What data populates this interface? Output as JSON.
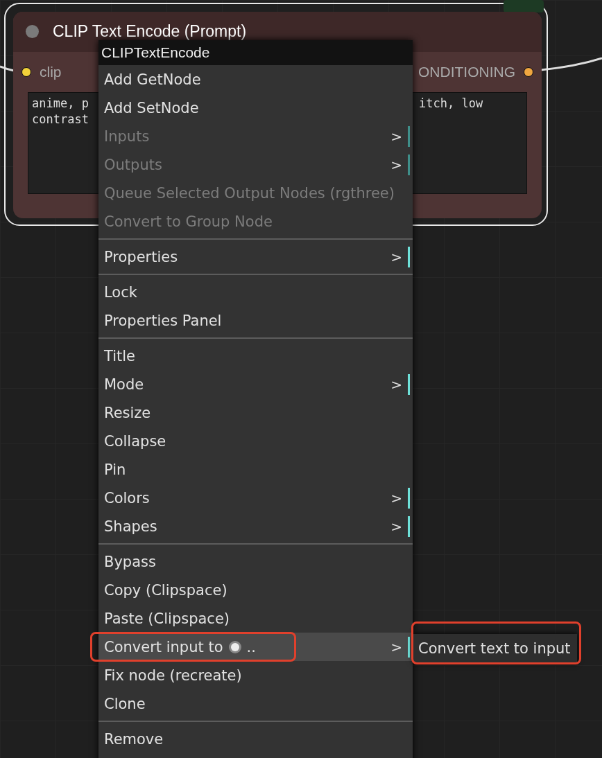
{
  "node": {
    "title": "CLIP Text Encode (Prompt)",
    "selected": true,
    "input": {
      "label": "clip",
      "color": "#f2d13a"
    },
    "output": {
      "label": "ONDITIONING",
      "color": "#f0a640"
    },
    "text_lines": [
      {
        "left": "anime, p",
        "right": "itch, low"
      },
      {
        "left": "contrast"
      }
    ]
  },
  "context_menu": {
    "title": "CLIPTextEncode",
    "items": [
      {
        "kind": "item",
        "label": "Add GetNode",
        "disabled": false,
        "submenu": false,
        "selected": false
      },
      {
        "kind": "item",
        "label": "Add SetNode",
        "disabled": false,
        "submenu": false,
        "selected": false
      },
      {
        "kind": "item",
        "label": "Inputs",
        "disabled": true,
        "submenu": true,
        "selected": false
      },
      {
        "kind": "item",
        "label": "Outputs",
        "disabled": true,
        "submenu": true,
        "selected": false
      },
      {
        "kind": "item",
        "label": "Queue Selected Output Nodes (rgthree)",
        "disabled": true,
        "submenu": false,
        "selected": false
      },
      {
        "kind": "item",
        "label": "Convert to Group Node",
        "disabled": true,
        "submenu": false,
        "selected": false
      },
      {
        "kind": "separator"
      },
      {
        "kind": "item",
        "label": "Properties",
        "disabled": false,
        "submenu": true,
        "selected": false
      },
      {
        "kind": "separator"
      },
      {
        "kind": "item",
        "label": "Lock",
        "disabled": false,
        "submenu": false,
        "selected": false
      },
      {
        "kind": "item",
        "label": "Properties Panel",
        "disabled": false,
        "submenu": false,
        "selected": false
      },
      {
        "kind": "separator"
      },
      {
        "kind": "item",
        "label": "Title",
        "disabled": false,
        "submenu": false,
        "selected": false
      },
      {
        "kind": "item",
        "label": "Mode",
        "disabled": false,
        "submenu": true,
        "selected": false
      },
      {
        "kind": "item",
        "label": "Resize",
        "disabled": false,
        "submenu": false,
        "selected": false
      },
      {
        "kind": "item",
        "label": "Collapse",
        "disabled": false,
        "submenu": false,
        "selected": false
      },
      {
        "kind": "item",
        "label": "Pin",
        "disabled": false,
        "submenu": false,
        "selected": false
      },
      {
        "kind": "item",
        "label": "Colors",
        "disabled": false,
        "submenu": true,
        "selected": false
      },
      {
        "kind": "item",
        "label": "Shapes",
        "disabled": false,
        "submenu": true,
        "selected": false
      },
      {
        "kind": "separator"
      },
      {
        "kind": "item",
        "label": "Bypass",
        "disabled": false,
        "submenu": false,
        "selected": false
      },
      {
        "kind": "item",
        "label": "Copy (Clipspace)",
        "disabled": false,
        "submenu": false,
        "selected": false
      },
      {
        "kind": "item",
        "label": "Paste (Clipspace)",
        "disabled": false,
        "submenu": false,
        "selected": false
      },
      {
        "kind": "item",
        "label": "Convert input to",
        "suffix": "..",
        "disabled": false,
        "submenu": true,
        "selected": true,
        "annotated": true
      },
      {
        "kind": "item",
        "label": "Fix node (recreate)",
        "disabled": false,
        "submenu": false,
        "selected": false
      },
      {
        "kind": "item",
        "label": "Clone",
        "disabled": false,
        "submenu": false,
        "selected": false
      },
      {
        "kind": "separator"
      },
      {
        "kind": "item",
        "label": "Remove",
        "disabled": false,
        "submenu": false,
        "selected": false
      }
    ]
  },
  "submenu": {
    "items": [
      {
        "label": "Convert text to input",
        "annotated": true
      }
    ]
  },
  "arrow_glyph": ">"
}
